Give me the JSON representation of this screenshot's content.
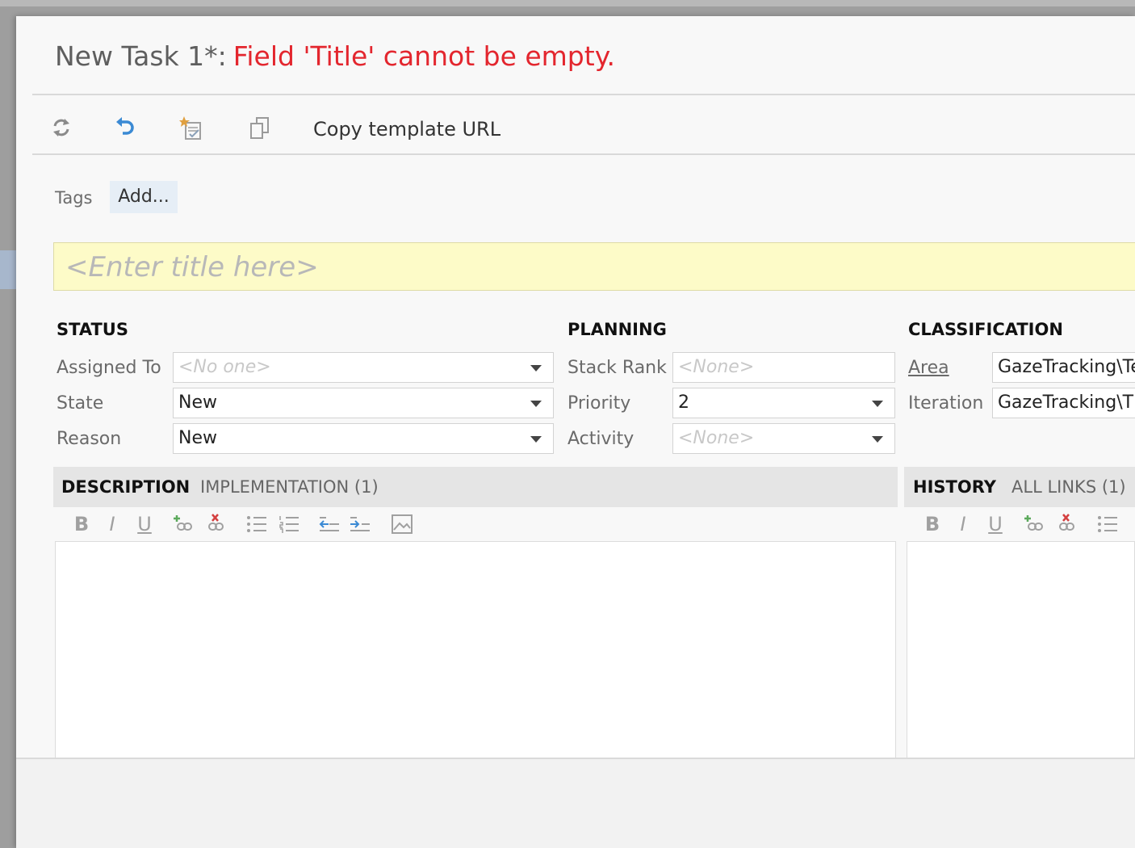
{
  "header": {
    "task_title": "New Task 1*:",
    "error_message": "Field 'Title' cannot be empty."
  },
  "toolbar": {
    "refresh_icon": "refresh-icon",
    "undo_icon": "undo-icon",
    "template_icon": "save-template-icon",
    "copy_icon": "copy-icon",
    "copy_template_label": "Copy template URL"
  },
  "tags": {
    "label": "Tags",
    "add_label": "Add..."
  },
  "title_field": {
    "placeholder": "<Enter title here>"
  },
  "status": {
    "heading": "STATUS",
    "assigned_to": {
      "label": "Assigned To",
      "value": "<No one>"
    },
    "state": {
      "label": "State",
      "value": "New"
    },
    "reason": {
      "label": "Reason",
      "value": "New"
    }
  },
  "planning": {
    "heading": "PLANNING",
    "stack_rank": {
      "label": "Stack Rank",
      "value": "<None>"
    },
    "priority": {
      "label": "Priority",
      "value": "2"
    },
    "activity": {
      "label": "Activity",
      "value": "<None>"
    }
  },
  "classification": {
    "heading": "CLASSIFICATION",
    "area": {
      "label": "Area",
      "value": "GazeTracking\\Te"
    },
    "iteration": {
      "label": "Iteration",
      "value": "GazeTracking\\TF"
    }
  },
  "left_tabs": [
    {
      "label": "DESCRIPTION",
      "active": true
    },
    {
      "label": "IMPLEMENTATION (1)",
      "active": false
    }
  ],
  "right_tabs": [
    {
      "label": "HISTORY",
      "active": true
    },
    {
      "label": "ALL LINKS (1)",
      "active": false
    }
  ],
  "editor_toolbar": {
    "bold": "B",
    "italic": "I",
    "underline": "U"
  },
  "colors": {
    "error_red": "#e3262e",
    "title_bg": "#fdfbc8",
    "undo_blue": "#3b8ad4",
    "tab_bar": "#e5e5e5"
  }
}
